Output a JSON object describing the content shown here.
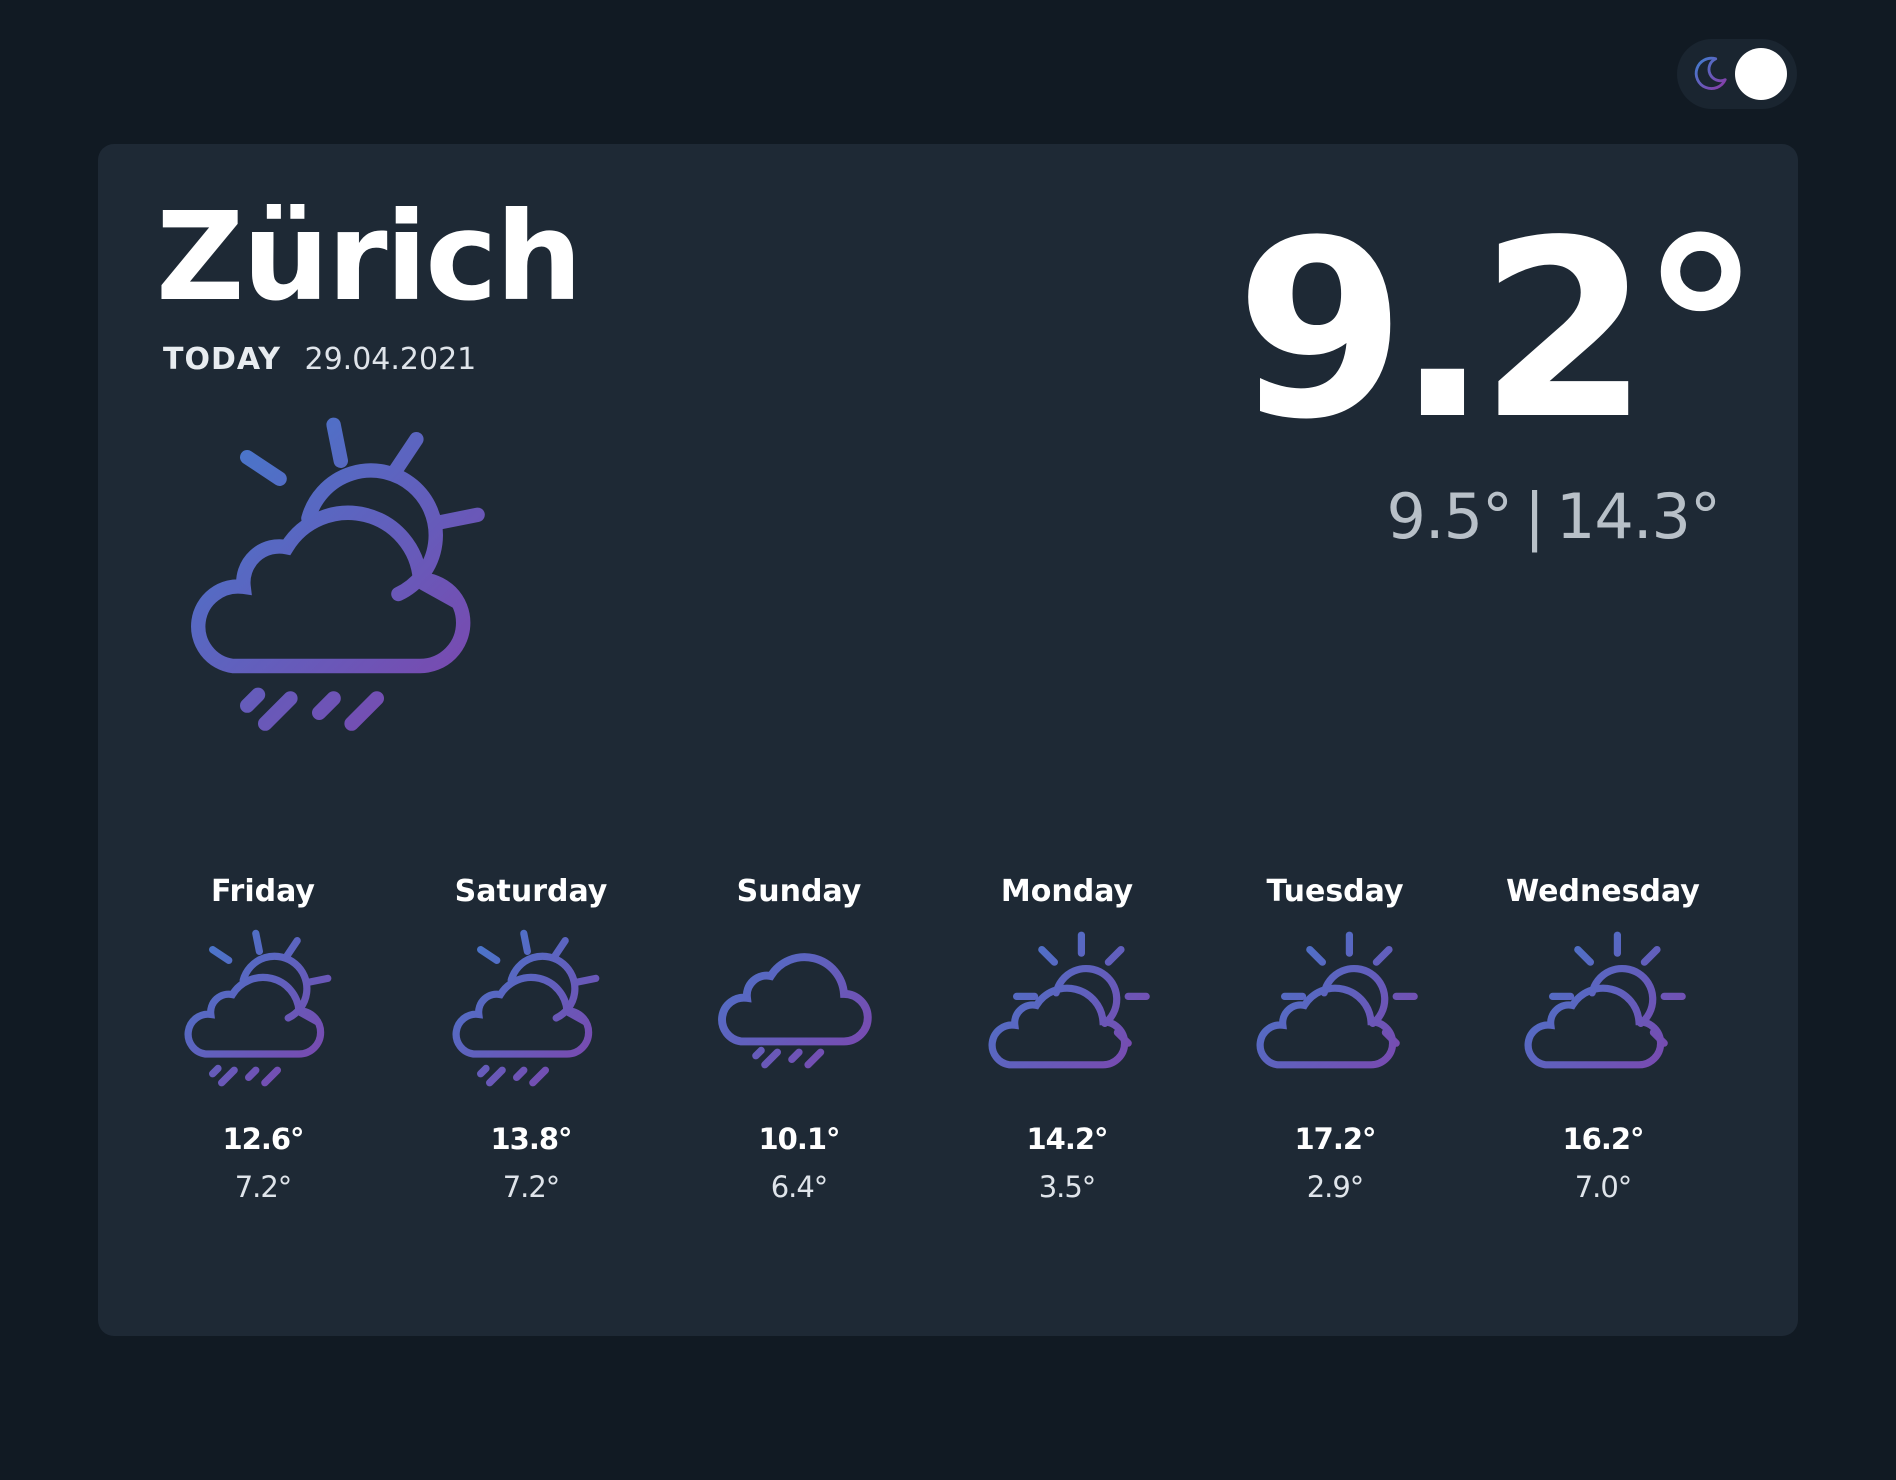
{
  "theme_toggle": {
    "mode": "dark",
    "icon": "moon-icon"
  },
  "current": {
    "city": "Zürich",
    "today_label": "TODAY",
    "date": "29.04.2021",
    "temperature": "9.2°",
    "min": "9.5°",
    "separator": "|",
    "max": "14.3°",
    "icon": "cloud-sun-rain-icon"
  },
  "forecast": [
    {
      "day": "Friday",
      "high": "12.6°",
      "low": "7.2°",
      "icon": "cloud-sun-rain-icon"
    },
    {
      "day": "Saturday",
      "high": "13.8°",
      "low": "7.2°",
      "icon": "cloud-sun-rain-icon"
    },
    {
      "day": "Sunday",
      "high": "10.1°",
      "low": "6.4°",
      "icon": "cloud-rain-icon"
    },
    {
      "day": "Monday",
      "high": "14.2°",
      "low": "3.5°",
      "icon": "cloud-sun-icon"
    },
    {
      "day": "Tuesday",
      "high": "17.2°",
      "low": "2.9°",
      "icon": "cloud-sun-icon"
    },
    {
      "day": "Wednesday",
      "high": "16.2°",
      "low": "7.0°",
      "icon": "cloud-sun-icon"
    }
  ],
  "colors": {
    "background": "#111a23",
    "card": "#1e2935",
    "gradient_start": "#3f7fd0",
    "gradient_end": "#8a3aa6"
  }
}
